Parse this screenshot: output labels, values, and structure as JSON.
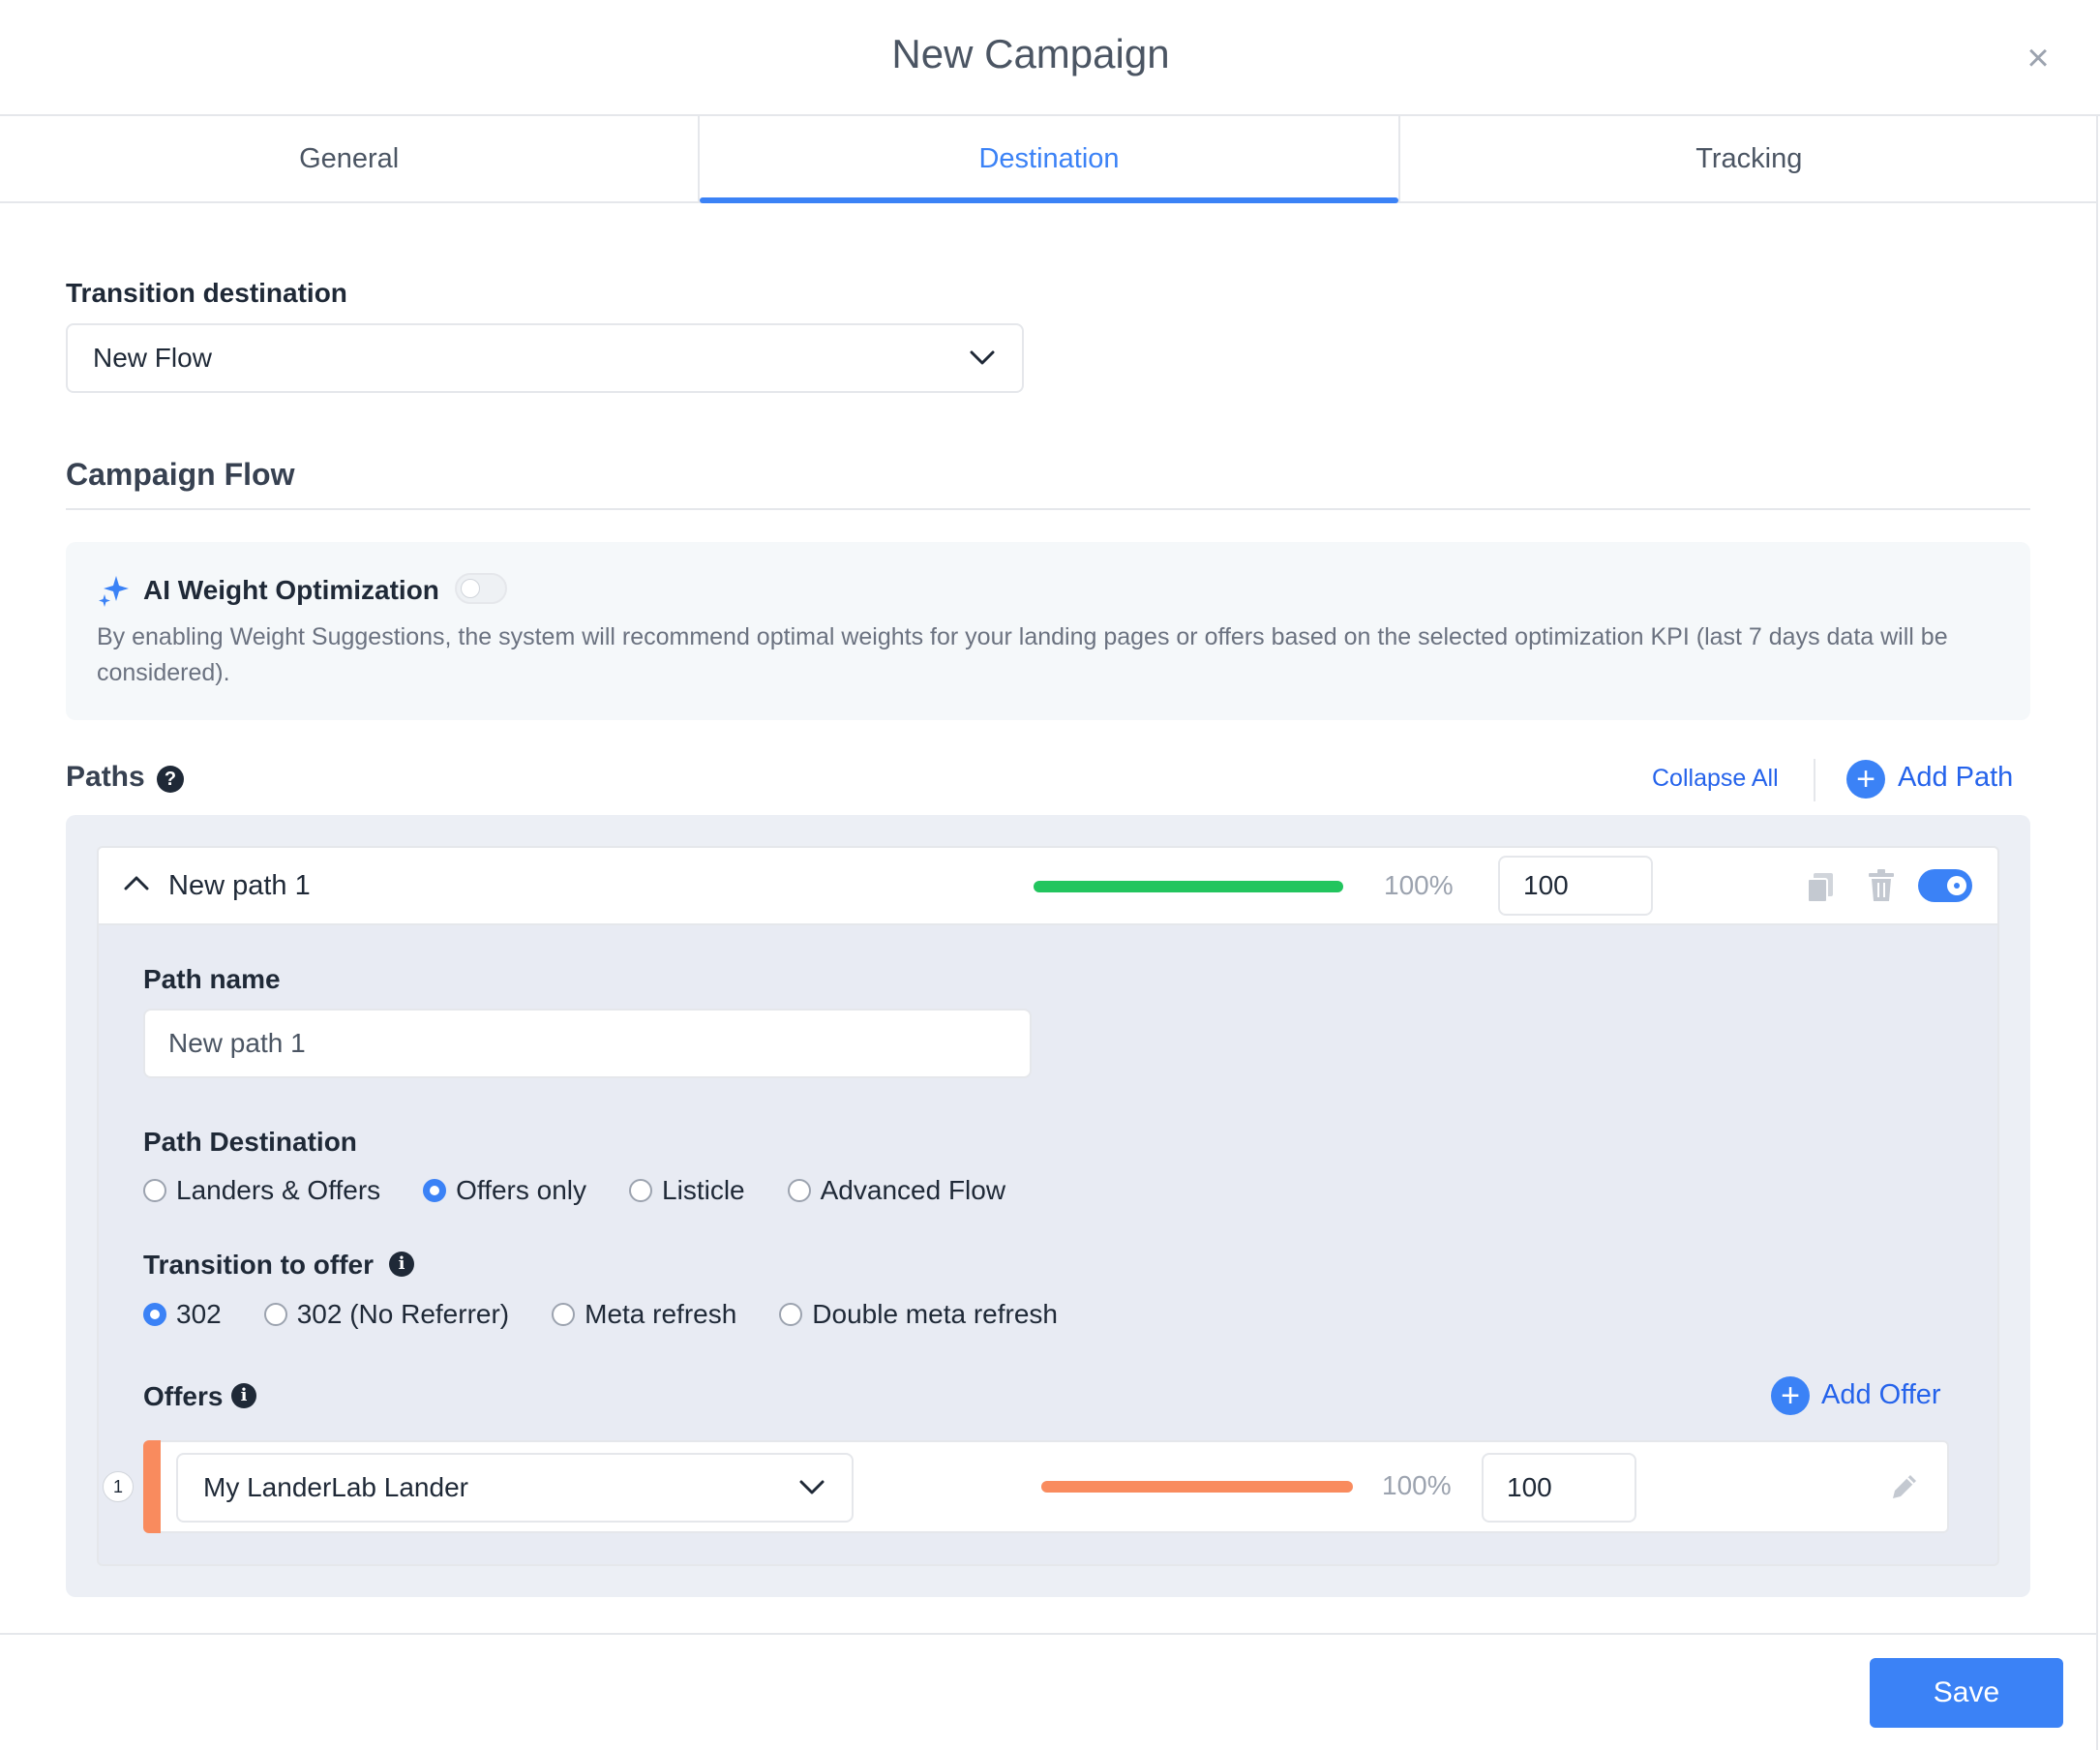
{
  "modal": {
    "title": "New Campaign",
    "close_label": "×"
  },
  "tabs": [
    {
      "label": "General",
      "active": false
    },
    {
      "label": "Destination",
      "active": true
    },
    {
      "label": "Tracking",
      "active": false
    }
  ],
  "transition_destination": {
    "label": "Transition destination",
    "value": "New Flow"
  },
  "campaign_flow": {
    "title": "Campaign Flow"
  },
  "ai_weight": {
    "title": "AI Weight Optimization",
    "enabled": false,
    "description": "By enabling Weight Suggestions, the system will recommend optimal weights for your landing pages or offers based on the selected optimization KPI (last 7 days data will be considered)."
  },
  "paths": {
    "title": "Paths",
    "help_icon": "?",
    "collapse_all": "Collapse All",
    "add_path": "Add Path",
    "add_icon": "+",
    "items": [
      {
        "name": "New path 1",
        "share_percent": "100%",
        "share_fraction": 1.0,
        "bar_color": "#22c55e",
        "weight": "100",
        "enabled": true,
        "path_name_label": "Path name",
        "path_name_value": "New path 1",
        "destination_label": "Path Destination",
        "destination_options": [
          "Landers & Offers",
          "Offers only",
          "Listicle",
          "Advanced Flow"
        ],
        "destination_selected": "Offers only",
        "transition_label": "Transition to offer",
        "transition_options": [
          "302",
          "302 (No Referrer)",
          "Meta refresh",
          "Double meta refresh"
        ],
        "transition_selected": "302",
        "offers_label": "Offers",
        "add_offer": "Add Offer",
        "offers": [
          {
            "index": "1",
            "name": "My LanderLab Lander",
            "share_percent": "100%",
            "share_fraction": 1.0,
            "bar_color": "#f98b5e",
            "weight": "100"
          }
        ]
      }
    ]
  },
  "info_icon": "i",
  "footer": {
    "save_label": "Save"
  },
  "colors": {
    "accent": "#3b82f6",
    "path_bar": "#22c55e",
    "offer_bar": "#f98b5e"
  }
}
